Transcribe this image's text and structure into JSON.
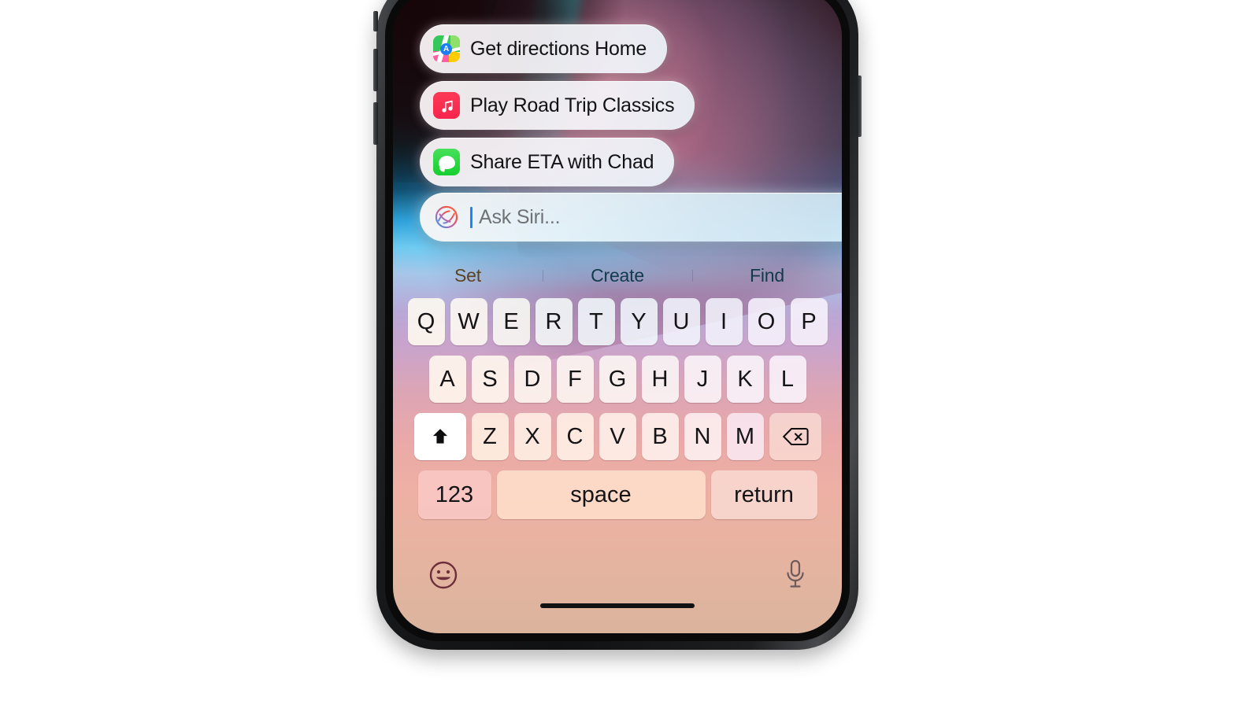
{
  "device": {
    "name": "iphone",
    "buttons": [
      "silent-switch",
      "volume-up",
      "volume-down",
      "power"
    ]
  },
  "assistant": {
    "suggestions": [
      {
        "label": "Get directions Home",
        "icon": "maps-icon",
        "app": "Maps"
      },
      {
        "label": "Play Road Trip Classics",
        "icon": "music-icon",
        "app": "Music"
      },
      {
        "label": "Share ETA with Chad",
        "icon": "messages-icon",
        "app": "Messages"
      }
    ],
    "input": {
      "placeholder": "Ask Siri...",
      "value": "",
      "icon": "siri-glyph-icon",
      "caret_color": "#1a84ff"
    }
  },
  "keyboard": {
    "predictive": [
      {
        "label": "Set"
      },
      {
        "label": "Create"
      },
      {
        "label": "Find"
      }
    ],
    "rows": [
      [
        "Q",
        "W",
        "E",
        "R",
        "T",
        "Y",
        "U",
        "I",
        "O",
        "P"
      ],
      [
        "A",
        "S",
        "D",
        "F",
        "G",
        "H",
        "J",
        "K",
        "L"
      ],
      [
        "Z",
        "X",
        "C",
        "V",
        "B",
        "N",
        "M"
      ]
    ],
    "shift": {
      "icon": "shift-arrow-icon",
      "state": "active"
    },
    "delete": {
      "icon": "delete-backward-icon"
    },
    "bottom_row": {
      "numbers": "123",
      "space": "space",
      "return": "return"
    },
    "emoji": {
      "icon": "emoji-smiley-icon"
    },
    "dictation": {
      "icon": "microphone-icon"
    }
  },
  "colors": {
    "music_red": "#f8234d",
    "messages_green": "#15cf2e",
    "caret_blue": "#1a84ff",
    "predictive_text": "#123a4d"
  }
}
